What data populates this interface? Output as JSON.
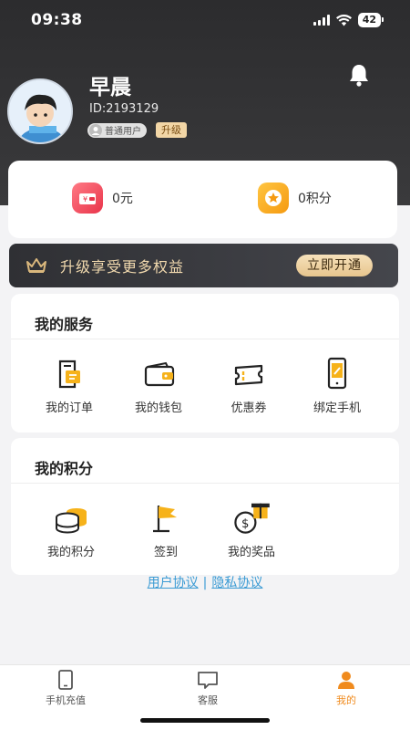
{
  "status_bar": {
    "time": "09:38",
    "battery": "42"
  },
  "profile": {
    "name": "早晨",
    "id_text": "ID:2193129",
    "level_badge": "普通用户",
    "upgrade_badge": "升级"
  },
  "balance": {
    "money": "0元",
    "points": "0积分"
  },
  "vip": {
    "text": "升级享受更多权益",
    "button": "立即开通"
  },
  "services": {
    "title": "我的服务",
    "items": [
      {
        "label": "我的订单",
        "icon": "order-icon"
      },
      {
        "label": "我的钱包",
        "icon": "wallet-icon"
      },
      {
        "label": "优惠券",
        "icon": "coupon-icon"
      },
      {
        "label": "绑定手机",
        "icon": "phone-bind-icon"
      }
    ]
  },
  "points_section": {
    "title": "我的积分",
    "items": [
      {
        "label": "我的积分",
        "icon": "coins-icon"
      },
      {
        "label": "签到",
        "icon": "checkin-flag-icon"
      },
      {
        "label": "我的奖品",
        "icon": "prize-gift-icon"
      }
    ]
  },
  "links": {
    "user_agreement": "用户协议",
    "separator": "|",
    "privacy": "隐私协议"
  },
  "tabs": [
    {
      "label": "手机充值",
      "icon": "phone-icon"
    },
    {
      "label": "客服",
      "icon": "chat-icon"
    },
    {
      "label": "我的",
      "icon": "user-icon",
      "active": true
    }
  ],
  "colors": {
    "accent": "#f08b1e",
    "gold": "#f1d9ae",
    "link": "#3b9bd4"
  }
}
